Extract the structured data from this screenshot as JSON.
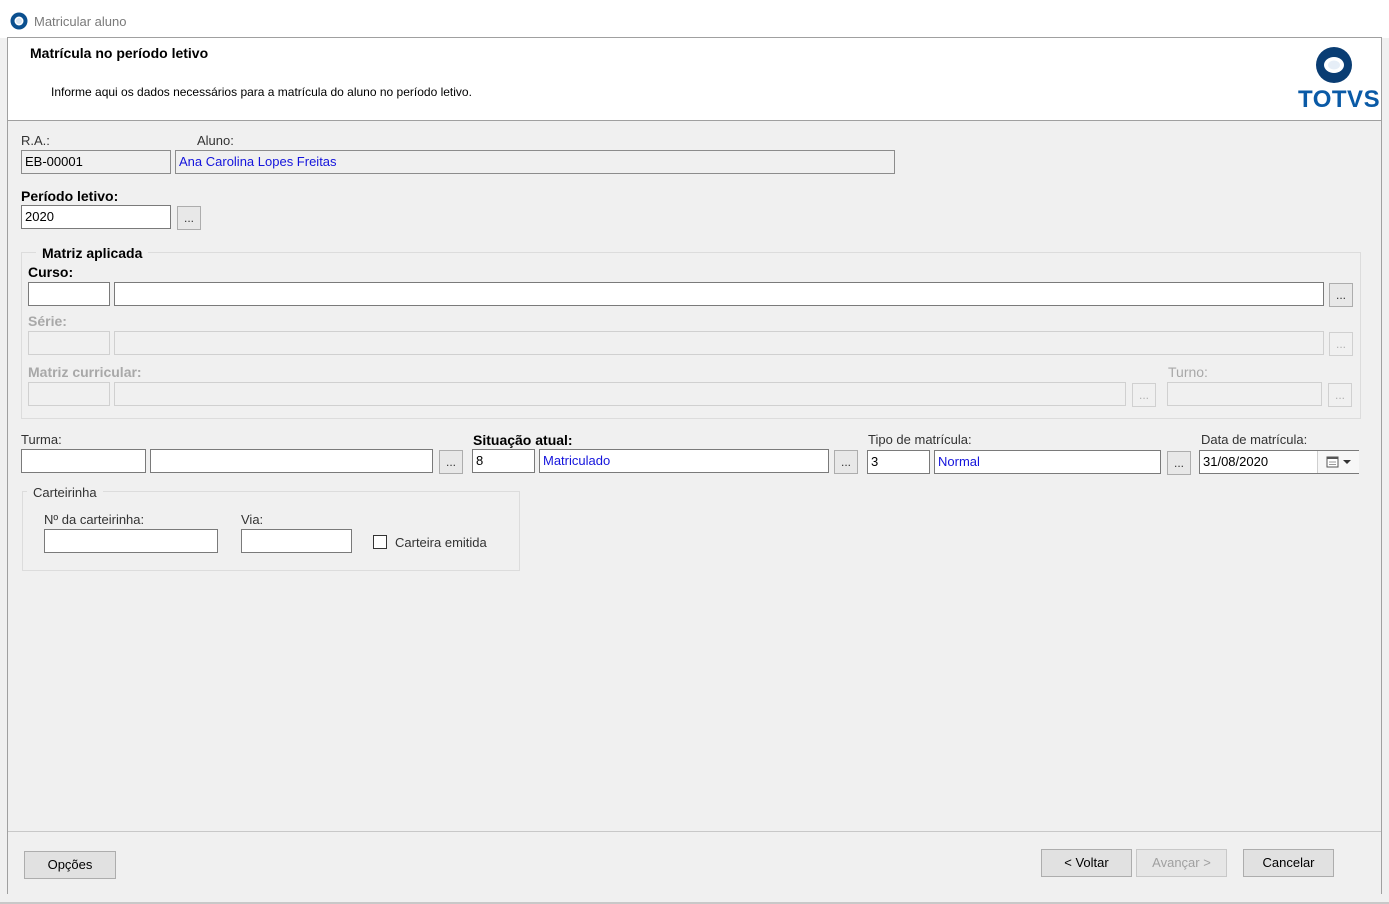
{
  "window": {
    "title": "Matricular aluno"
  },
  "header": {
    "title": "Matrícula no período letivo",
    "description": "Informe aqui os dados necessários para a matrícula do aluno no período letivo.",
    "logo_text": "TOTVS"
  },
  "student": {
    "ra_label": "R.A.:",
    "ra_value": "EB-00001",
    "aluno_label": "Aluno:",
    "aluno_value": "Ana Carolina Lopes Freitas"
  },
  "periodo": {
    "label": "Período letivo:",
    "value": "2020",
    "lookup_label": "..."
  },
  "matriz": {
    "group_title": "Matriz aplicada",
    "curso_label": "Curso:",
    "curso_code": "",
    "curso_name": "",
    "serie_label": "Série:",
    "matriz_label": "Matriz curricular:",
    "turno_label": "Turno:",
    "lookup_label": "..."
  },
  "turma": {
    "label": "Turma:",
    "code": "",
    "name": "",
    "lookup_label": "..."
  },
  "situacao": {
    "label": "Situação atual:",
    "code": "8",
    "name": "Matriculado",
    "lookup_label": "..."
  },
  "tipo": {
    "label": "Tipo de matrícula:",
    "code": "3",
    "name": "Normal",
    "lookup_label": "..."
  },
  "data": {
    "label": "Data de matrícula:",
    "value": "31/08/2020"
  },
  "carteirinha": {
    "group_title": "Carteirinha",
    "numero_label": "Nº da carteirinha:",
    "numero_value": "",
    "via_label": "Via:",
    "via_value": "",
    "emitida_label": "Carteira emitida",
    "emitida_checked": false
  },
  "footer": {
    "opcoes_label": "Opções",
    "voltar_label": "< Voltar",
    "avancar_label": "Avançar >",
    "cancelar_label": "Cancelar"
  },
  "colors": {
    "brand": "#0a5aa6",
    "link_text": "#1414dc"
  }
}
